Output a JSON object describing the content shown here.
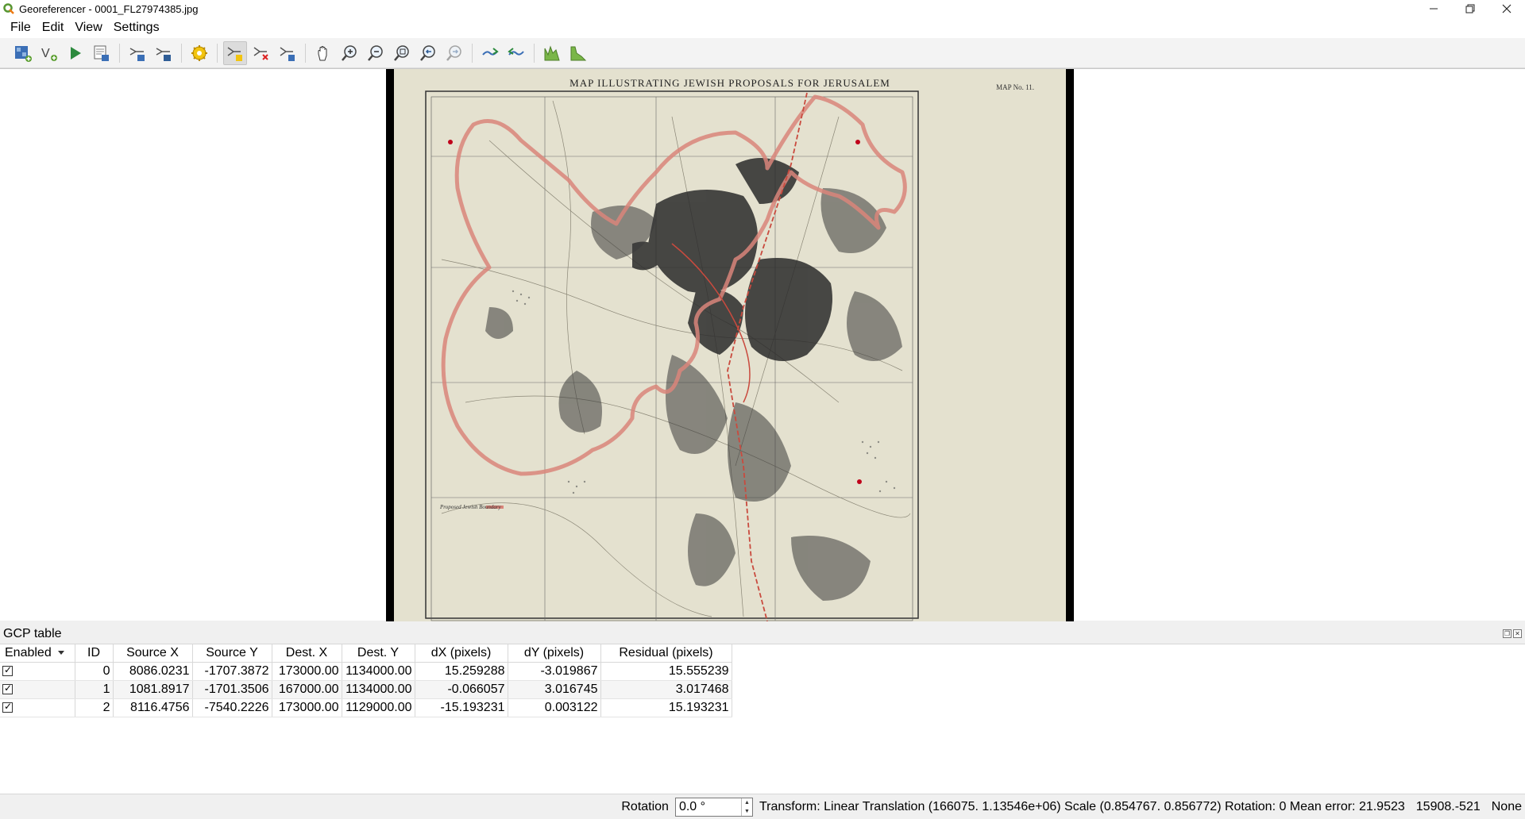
{
  "window": {
    "title": "Georeferencer - 0001_FL27974385.jpg",
    "controls": {
      "minimize": "—",
      "restore": "❐",
      "close": "✕"
    }
  },
  "menu": [
    "File",
    "Edit",
    "View",
    "Settings"
  ],
  "toolbar": {
    "icons": [
      "open-raster-icon",
      "start-georeferencing-icon",
      "generate-script-icon",
      "load-gcp-icon",
      "save-gcp-icon",
      "transformation-settings-icon",
      "add-point-icon",
      "delete-point-icon",
      "move-point-icon",
      "pan-icon",
      "zoom-in-icon",
      "zoom-out-icon",
      "zoom-to-layer-icon",
      "zoom-last-icon",
      "zoom-next-icon",
      "link-georef-icon",
      "link-qgis-icon",
      "full-histogram-icon",
      "local-histogram-icon"
    ],
    "active": "add-point-icon"
  },
  "map": {
    "title": "MAP ILLUSTRATING JEWISH PROPOSALS FOR JERUSALEM",
    "map_no": "MAP No. 11.",
    "legend": "Proposed Jewish Boundary",
    "colors": {
      "paper": "#e4e1cf",
      "boundary": "#d9857a",
      "ink": "#2b2b2b",
      "gcp": "#c0001a"
    }
  },
  "gcp_panel": {
    "title": "GCP table",
    "columns": [
      "Enabled",
      "ID",
      "Source X",
      "Source Y",
      "Dest. X",
      "Dest. Y",
      "dX (pixels)",
      "dY (pixels)",
      "Residual (pixels)"
    ],
    "rows": [
      {
        "enabled": true,
        "id": "0",
        "source_x": "8086.0231",
        "source_y": "-1707.3872",
        "dest_x": "173000.00",
        "dest_y": "1134000.00",
        "dx": "15.259288",
        "dy": "-3.019867",
        "residual": "15.555239"
      },
      {
        "enabled": true,
        "id": "1",
        "source_x": "1081.8917",
        "source_y": "-1701.3506",
        "dest_x": "167000.00",
        "dest_y": "1134000.00",
        "dx": "-0.066057",
        "dy": "3.016745",
        "residual": "3.017468"
      },
      {
        "enabled": true,
        "id": "2",
        "source_x": "8116.4756",
        "source_y": "-7540.2226",
        "dest_x": "173000.00",
        "dest_y": "1129000.00",
        "dx": "-15.193231",
        "dy": "0.003122",
        "residual": "15.193231"
      }
    ]
  },
  "status": {
    "rotation_label": "Rotation",
    "rotation_value": "0.0 °",
    "transform": "Transform: Linear Translation (166075. 1.13546e+06) Scale (0.854767. 0.856772) Rotation: 0 Mean error: 21.9523",
    "coords": "15908.-521",
    "crs": "None"
  }
}
